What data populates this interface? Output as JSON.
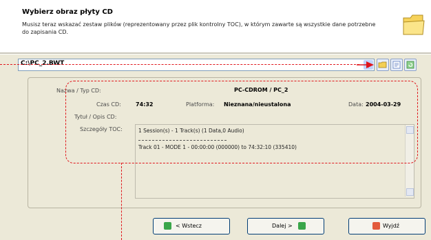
{
  "header": {
    "title": "Wybierz obraz płyty CD",
    "description": "Musisz teraz wskazać zestaw plików (reprezentowany przez plik kontrolny TOC), w którym zawarte są wszystkie dane potrzebne do zapisania CD."
  },
  "path_combo": {
    "value": "C:\\PC_2.BWT"
  },
  "details": {
    "name_label": "Nazwa / Typ CD:",
    "name_value": "PC-CDROM / PC_2",
    "time_label": "Czas CD:",
    "time_value": "74:32",
    "platform_label": "Platforma:",
    "platform_value": "Nieznana/nieustalona",
    "date_label": "Data:",
    "date_value": "2004-03-29",
    "title_label": "Tytuł / Opis CD:",
    "title_value": "",
    "toc_label": "Szczegóły TOC:",
    "toc_lines": [
      "1 Session(s) - 1 Track(s) (1 Data,0 Audio)",
      "Track 01 - MODE 1 - 00:00:00 (000000) to 74:32:10 (335410)"
    ]
  },
  "buttons": {
    "back": "< Wstecz",
    "next": "Dalej >",
    "exit": "Wyjdź"
  },
  "colors": {
    "annotation": "#e0151b",
    "button_border": "#003c74",
    "back_icon": "#3aa64a",
    "next_icon": "#3aa64a",
    "exit_icon": "#e35a3c"
  }
}
